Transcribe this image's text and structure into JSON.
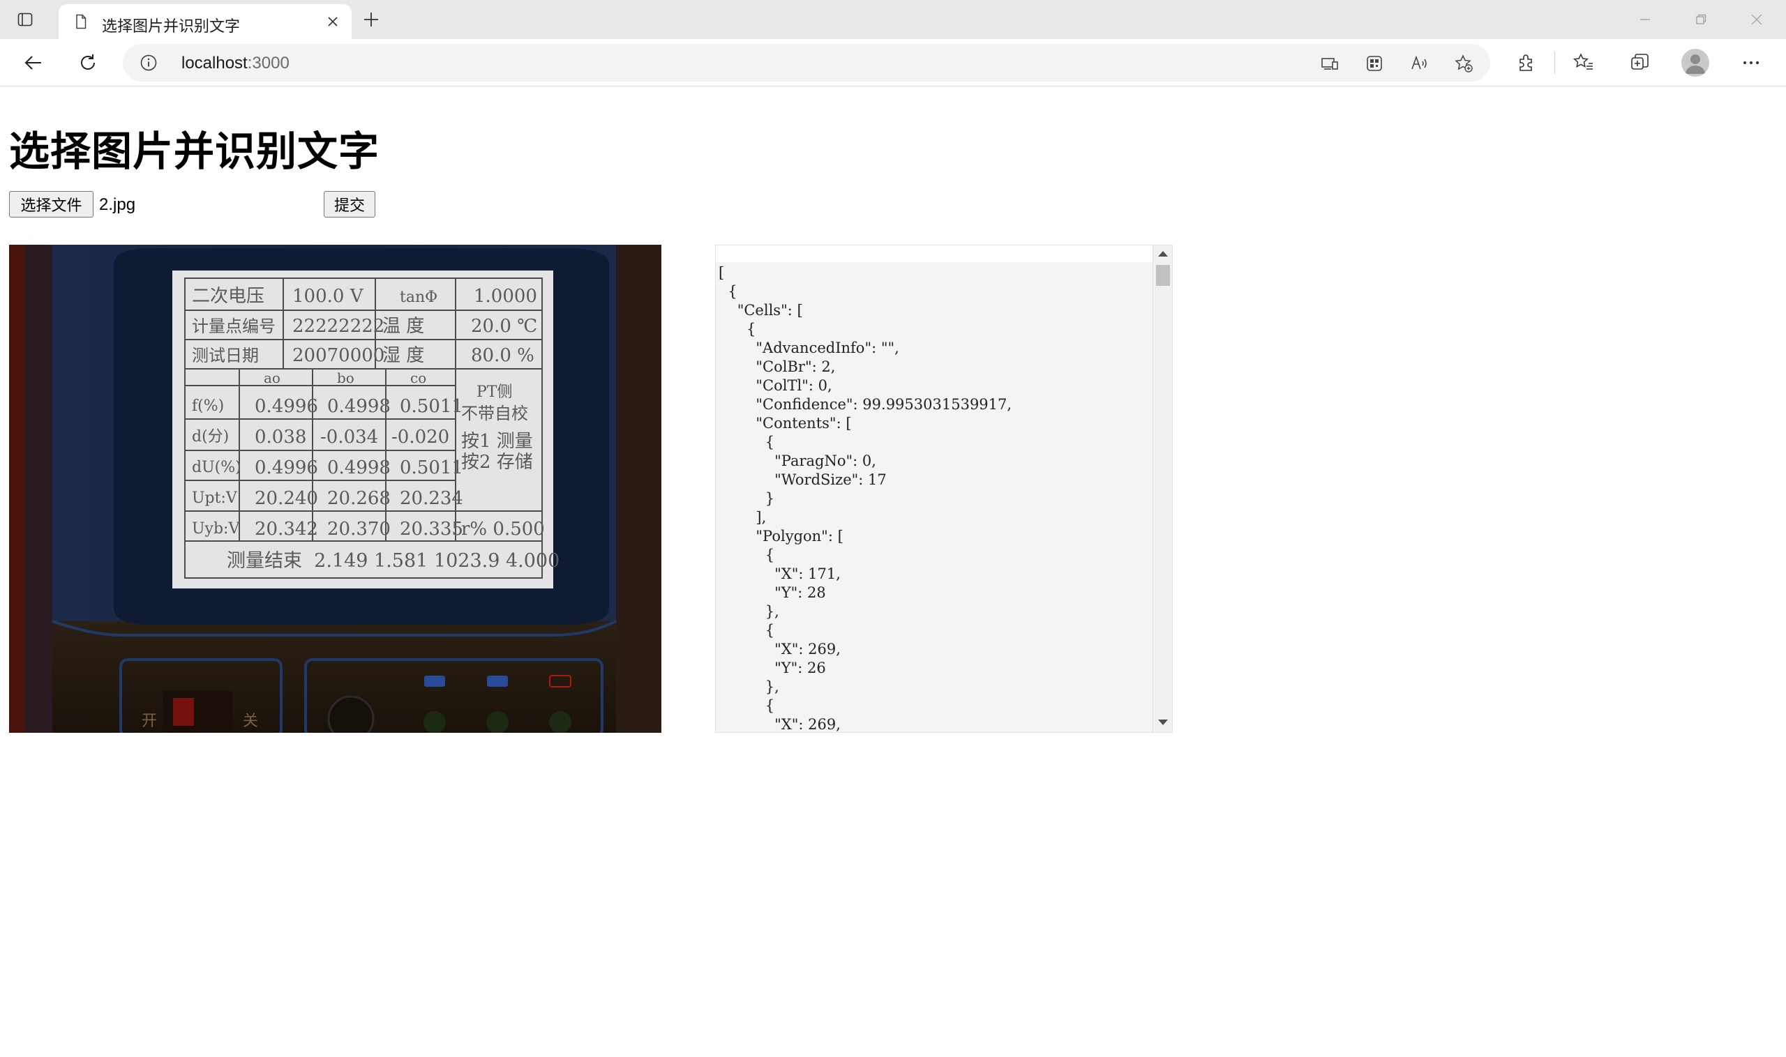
{
  "browser": {
    "tab_title": "选择图片并识别文字",
    "url_host": "localhost",
    "url_port": ":3000"
  },
  "page": {
    "title": "选择图片并识别文字",
    "choose_file_label": "选择文件",
    "file_name": "2.jpg",
    "submit_label": "提交"
  },
  "preview_image": {
    "table": [
      [
        "二次电压",
        "100.0 V",
        "tanΦ",
        "1.0000"
      ],
      [
        "计量点编号",
        "22222222",
        "温    度",
        "20.0 ℃"
      ],
      [
        "测试日期",
        "20070000",
        "湿    度",
        "80.0 %"
      ]
    ],
    "grid_headers": [
      "ao",
      "bo",
      "co"
    ],
    "side_label": "PT侧",
    "side_note": "不带自校",
    "rows": [
      {
        "label": "f(%)",
        "values": [
          "0.4996",
          "0.4998",
          "0.5011"
        ]
      },
      {
        "label": "d(分)",
        "values": [
          "0.038",
          "-0.034",
          "-0.020"
        ]
      },
      {
        "label": "dU(%)",
        "values": [
          "0.4996",
          "0.4998",
          "0.5011"
        ]
      },
      {
        "label": "Upt:V",
        "values": [
          "20.240",
          "20.268",
          "20.234"
        ]
      },
      {
        "label": "Uyb:V",
        "values": [
          "20.342",
          "20.370",
          "20.335"
        ]
      }
    ],
    "key_hint_1": "按1 测量",
    "key_hint_2": "按2 存储",
    "r_value": "r% 0.500",
    "footer": "测量结束  2.149 1.581 1023.9 4.000",
    "switch_on": "开",
    "switch_off": "关"
  },
  "result_text": "[\n  {\n    \"Cells\": [\n      {\n        \"AdvancedInfo\": \"\",\n        \"ColBr\": 2,\n        \"ColTl\": 0,\n        \"Confidence\": 99.9953031539917,\n        \"Contents\": [\n          {\n            \"ParagNo\": 0,\n            \"WordSize\": 17\n          }\n        ],\n        \"Polygon\": [\n          {\n            \"X\": 171,\n            \"Y\": 28\n          },\n          {\n            \"X\": 269,\n            \"Y\": 26\n          },\n          {\n            \"X\": 269,"
}
